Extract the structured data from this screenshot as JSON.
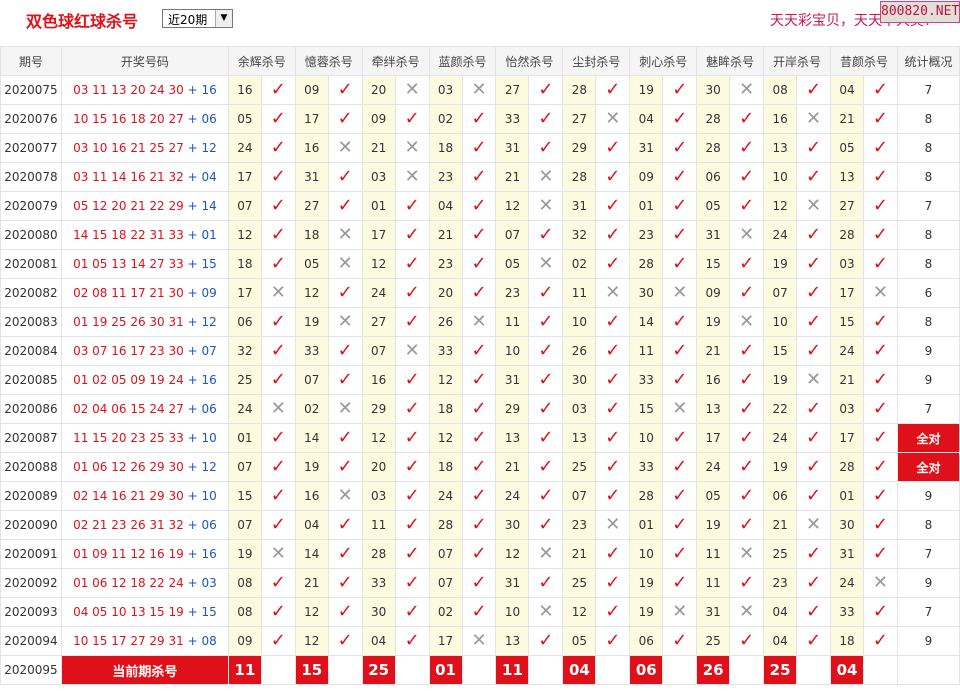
{
  "header": {
    "title": "双色球红球杀号",
    "period_select": "近20期",
    "slogan": "天天彩宝贝，天天中大奖！",
    "badge": "800820.NET"
  },
  "columns": {
    "period": "期号",
    "draw": "开奖号码",
    "experts": [
      "余辉杀号",
      "憶蓉杀号",
      "牵绊杀号",
      "蓝颜杀号",
      "怡然杀号",
      "尘封杀号",
      "刺心杀号",
      "魅眸杀号",
      "开岸杀号",
      "昔颜杀号"
    ],
    "stats": "统计概况"
  },
  "rows": [
    {
      "period": "2020075",
      "red": "03 11 13 20 24 30",
      "plus": "+",
      "blue": "16",
      "kills": [
        [
          "16",
          1
        ],
        [
          "09",
          1
        ],
        [
          "20",
          0
        ],
        [
          "03",
          0
        ],
        [
          "27",
          1
        ],
        [
          "28",
          1
        ],
        [
          "19",
          1
        ],
        [
          "30",
          0
        ],
        [
          "08",
          1
        ],
        [
          "04",
          1
        ]
      ],
      "stat": "7"
    },
    {
      "period": "2020076",
      "red": "10 15 16 18 20 27",
      "plus": "+",
      "blue": "06",
      "kills": [
        [
          "05",
          1
        ],
        [
          "17",
          1
        ],
        [
          "09",
          1
        ],
        [
          "02",
          1
        ],
        [
          "33",
          1
        ],
        [
          "27",
          0
        ],
        [
          "04",
          1
        ],
        [
          "28",
          1
        ],
        [
          "16",
          0
        ],
        [
          "21",
          1
        ]
      ],
      "stat": "8"
    },
    {
      "period": "2020077",
      "red": "03 10 16 21 25 27",
      "plus": "+",
      "blue": "12",
      "kills": [
        [
          "24",
          1
        ],
        [
          "16",
          0
        ],
        [
          "21",
          0
        ],
        [
          "18",
          1
        ],
        [
          "31",
          1
        ],
        [
          "29",
          1
        ],
        [
          "31",
          1
        ],
        [
          "28",
          1
        ],
        [
          "13",
          1
        ],
        [
          "05",
          1
        ]
      ],
      "stat": "8"
    },
    {
      "period": "2020078",
      "red": "03 11 14 16 21 32",
      "plus": "+",
      "blue": "04",
      "kills": [
        [
          "17",
          1
        ],
        [
          "31",
          1
        ],
        [
          "03",
          0
        ],
        [
          "23",
          1
        ],
        [
          "21",
          0
        ],
        [
          "28",
          1
        ],
        [
          "09",
          1
        ],
        [
          "06",
          1
        ],
        [
          "10",
          1
        ],
        [
          "13",
          1
        ]
      ],
      "stat": "8"
    },
    {
      "period": "2020079",
      "red": "05 12 20 21 22 29",
      "plus": "+",
      "blue": "14",
      "kills": [
        [
          "07",
          1
        ],
        [
          "27",
          1
        ],
        [
          "01",
          1
        ],
        [
          "04",
          1
        ],
        [
          "12",
          0
        ],
        [
          "31",
          1
        ],
        [
          "01",
          1
        ],
        [
          "05",
          1
        ],
        [
          "12",
          0
        ],
        [
          "27",
          1
        ]
      ],
      "stat": "7"
    },
    {
      "period": "2020080",
      "red": "14 15 18 22 31 33",
      "plus": "+",
      "blue": "01",
      "kills": [
        [
          "12",
          1
        ],
        [
          "18",
          0
        ],
        [
          "17",
          1
        ],
        [
          "21",
          1
        ],
        [
          "07",
          1
        ],
        [
          "32",
          1
        ],
        [
          "23",
          1
        ],
        [
          "31",
          0
        ],
        [
          "24",
          1
        ],
        [
          "28",
          1
        ]
      ],
      "stat": "8"
    },
    {
      "period": "2020081",
      "red": "01 05 13 14 27 33",
      "plus": "+",
      "blue": "15",
      "kills": [
        [
          "18",
          1
        ],
        [
          "05",
          0
        ],
        [
          "12",
          1
        ],
        [
          "23",
          1
        ],
        [
          "05",
          0
        ],
        [
          "02",
          1
        ],
        [
          "28",
          1
        ],
        [
          "15",
          1
        ],
        [
          "19",
          1
        ],
        [
          "03",
          1
        ]
      ],
      "stat": "8"
    },
    {
      "period": "2020082",
      "red": "02 08 11 17 21 30",
      "plus": "+",
      "blue": "09",
      "kills": [
        [
          "17",
          0
        ],
        [
          "12",
          1
        ],
        [
          "24",
          1
        ],
        [
          "20",
          1
        ],
        [
          "23",
          1
        ],
        [
          "11",
          0
        ],
        [
          "30",
          0
        ],
        [
          "09",
          1
        ],
        [
          "07",
          1
        ],
        [
          "17",
          0
        ]
      ],
      "stat": "6"
    },
    {
      "period": "2020083",
      "red": "01 19 25 26 30 31",
      "plus": "+",
      "blue": "12",
      "kills": [
        [
          "06",
          1
        ],
        [
          "19",
          0
        ],
        [
          "27",
          1
        ],
        [
          "26",
          0
        ],
        [
          "11",
          1
        ],
        [
          "10",
          1
        ],
        [
          "14",
          1
        ],
        [
          "19",
          0
        ],
        [
          "10",
          1
        ],
        [
          "15",
          1
        ]
      ],
      "stat": "8"
    },
    {
      "period": "2020084",
      "red": "03 07 16 17 23 30",
      "plus": "+",
      "blue": "07",
      "kills": [
        [
          "32",
          1
        ],
        [
          "33",
          1
        ],
        [
          "07",
          0
        ],
        [
          "33",
          1
        ],
        [
          "10",
          1
        ],
        [
          "26",
          1
        ],
        [
          "11",
          1
        ],
        [
          "21",
          1
        ],
        [
          "15",
          1
        ],
        [
          "24",
          1
        ]
      ],
      "stat": "9"
    },
    {
      "period": "2020085",
      "red": "01 02 05 09 19 24",
      "plus": "+",
      "blue": "16",
      "kills": [
        [
          "25",
          1
        ],
        [
          "07",
          1
        ],
        [
          "16",
          1
        ],
        [
          "12",
          1
        ],
        [
          "31",
          1
        ],
        [
          "30",
          1
        ],
        [
          "33",
          1
        ],
        [
          "16",
          1
        ],
        [
          "19",
          0
        ],
        [
          "21",
          1
        ]
      ],
      "stat": "9"
    },
    {
      "period": "2020086",
      "red": "02 04 06 15 24 27",
      "plus": "+",
      "blue": "06",
      "kills": [
        [
          "24",
          0
        ],
        [
          "02",
          0
        ],
        [
          "29",
          1
        ],
        [
          "18",
          1
        ],
        [
          "29",
          1
        ],
        [
          "03",
          1
        ],
        [
          "15",
          0
        ],
        [
          "13",
          1
        ],
        [
          "22",
          1
        ],
        [
          "03",
          1
        ]
      ],
      "stat": "7"
    },
    {
      "period": "2020087",
      "red": "11 15 20 23 25 33",
      "plus": "+",
      "blue": "10",
      "kills": [
        [
          "01",
          1
        ],
        [
          "14",
          1
        ],
        [
          "12",
          1
        ],
        [
          "12",
          1
        ],
        [
          "13",
          1
        ],
        [
          "13",
          1
        ],
        [
          "10",
          1
        ],
        [
          "17",
          1
        ],
        [
          "24",
          1
        ],
        [
          "17",
          1
        ]
      ],
      "stat": "全对",
      "all": true
    },
    {
      "period": "2020088",
      "red": "01 06 12 26 29 30",
      "plus": "+",
      "blue": "12",
      "kills": [
        [
          "07",
          1
        ],
        [
          "19",
          1
        ],
        [
          "20",
          1
        ],
        [
          "18",
          1
        ],
        [
          "21",
          1
        ],
        [
          "25",
          1
        ],
        [
          "33",
          1
        ],
        [
          "24",
          1
        ],
        [
          "19",
          1
        ],
        [
          "28",
          1
        ]
      ],
      "stat": "全对",
      "all": true
    },
    {
      "period": "2020089",
      "red": "02 14 16 21 29 30",
      "plus": "+",
      "blue": "10",
      "kills": [
        [
          "15",
          1
        ],
        [
          "16",
          0
        ],
        [
          "03",
          1
        ],
        [
          "24",
          1
        ],
        [
          "24",
          1
        ],
        [
          "07",
          1
        ],
        [
          "28",
          1
        ],
        [
          "05",
          1
        ],
        [
          "06",
          1
        ],
        [
          "01",
          1
        ]
      ],
      "stat": "9"
    },
    {
      "period": "2020090",
      "red": "02 21 23 26 31 32",
      "plus": "+",
      "blue": "06",
      "kills": [
        [
          "07",
          1
        ],
        [
          "04",
          1
        ],
        [
          "11",
          1
        ],
        [
          "28",
          1
        ],
        [
          "30",
          1
        ],
        [
          "23",
          0
        ],
        [
          "01",
          1
        ],
        [
          "19",
          1
        ],
        [
          "21",
          0
        ],
        [
          "30",
          1
        ]
      ],
      "stat": "8"
    },
    {
      "period": "2020091",
      "red": "01 09 11 12 16 19",
      "plus": "+",
      "blue": "16",
      "kills": [
        [
          "19",
          0
        ],
        [
          "14",
          1
        ],
        [
          "28",
          1
        ],
        [
          "07",
          1
        ],
        [
          "12",
          0
        ],
        [
          "21",
          1
        ],
        [
          "10",
          1
        ],
        [
          "11",
          0
        ],
        [
          "25",
          1
        ],
        [
          "31",
          1
        ]
      ],
      "stat": "7"
    },
    {
      "period": "2020092",
      "red": "01 06 12 18 22 24",
      "plus": "+",
      "blue": "03",
      "kills": [
        [
          "08",
          1
        ],
        [
          "21",
          1
        ],
        [
          "33",
          1
        ],
        [
          "07",
          1
        ],
        [
          "31",
          1
        ],
        [
          "25",
          1
        ],
        [
          "19",
          1
        ],
        [
          "11",
          1
        ],
        [
          "23",
          1
        ],
        [
          "24",
          0
        ]
      ],
      "stat": "9"
    },
    {
      "period": "2020093",
      "red": "04 05 10 13 15 19",
      "plus": "+",
      "blue": "15",
      "kills": [
        [
          "08",
          1
        ],
        [
          "12",
          1
        ],
        [
          "30",
          1
        ],
        [
          "02",
          1
        ],
        [
          "10",
          0
        ],
        [
          "12",
          1
        ],
        [
          "19",
          0
        ],
        [
          "31",
          0
        ],
        [
          "04",
          1
        ],
        [
          "33",
          1
        ]
      ],
      "stat": "7"
    },
    {
      "period": "2020094",
      "red": "10 15 17 27 29 31",
      "plus": "+",
      "blue": "08",
      "kills": [
        [
          "09",
          1
        ],
        [
          "12",
          1
        ],
        [
          "04",
          1
        ],
        [
          "17",
          0
        ],
        [
          "13",
          1
        ],
        [
          "05",
          1
        ],
        [
          "06",
          1
        ],
        [
          "25",
          1
        ],
        [
          "04",
          1
        ],
        [
          "18",
          1
        ]
      ],
      "stat": "9"
    }
  ],
  "footer": {
    "period": "2020095",
    "label": "当前期杀号",
    "kills": [
      "11",
      "15",
      "25",
      "01",
      "11",
      "04",
      "06",
      "26",
      "25",
      "04"
    ]
  },
  "marks": {
    "win": "✓",
    "miss": "✕"
  },
  "colors": {
    "accent_red": "#e0101a",
    "blue_ball": "#1a55c8",
    "kill_number_bg": "#fdfbdf"
  }
}
